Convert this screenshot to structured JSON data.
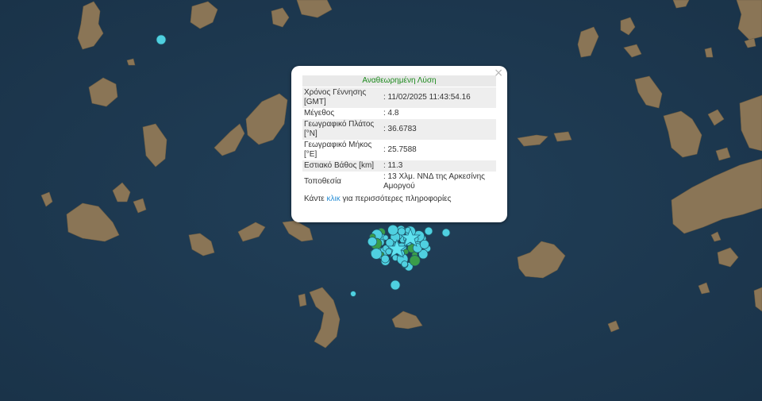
{
  "colors": {
    "sea": "#1e3a52",
    "land": "#8a7556",
    "quake_cyan": "#4fd0e0",
    "quake_green": "#3a9d4a",
    "star": "#5fe3f0",
    "title_green": "#1d8a1d",
    "link": "#2a8fd6"
  },
  "map": {
    "icons": {
      "epicenter": "star-icon",
      "close": "close-icon"
    }
  },
  "popup": {
    "close_glyph": "×",
    "title": "Αναθεωρημένη Λύση",
    "rows": [
      {
        "label": "Χρόνος Γέννησης [GMT]",
        "value": ": 11/02/2025 11:43:54.16"
      },
      {
        "label": "Μέγεθος",
        "value": ": 4.8"
      },
      {
        "label": "Γεωγραφικό Πλάτος [°N]",
        "value": ": 36.6783"
      },
      {
        "label": "Γεωγραφικό Μήκος [°E]",
        "value": ": 25.7588"
      },
      {
        "label": "Εστιακό Βάθος [km]",
        "value": ": 11.3"
      },
      {
        "label": "Τοποθεσία",
        "value": ": 13 Χλμ. ΝΝΔ της Αρκεσίνης Αμοργού"
      }
    ],
    "more_prefix": "Κάντε ",
    "more_link": "κλικ",
    "more_suffix": " για περισσότερες πληροφορίες"
  }
}
